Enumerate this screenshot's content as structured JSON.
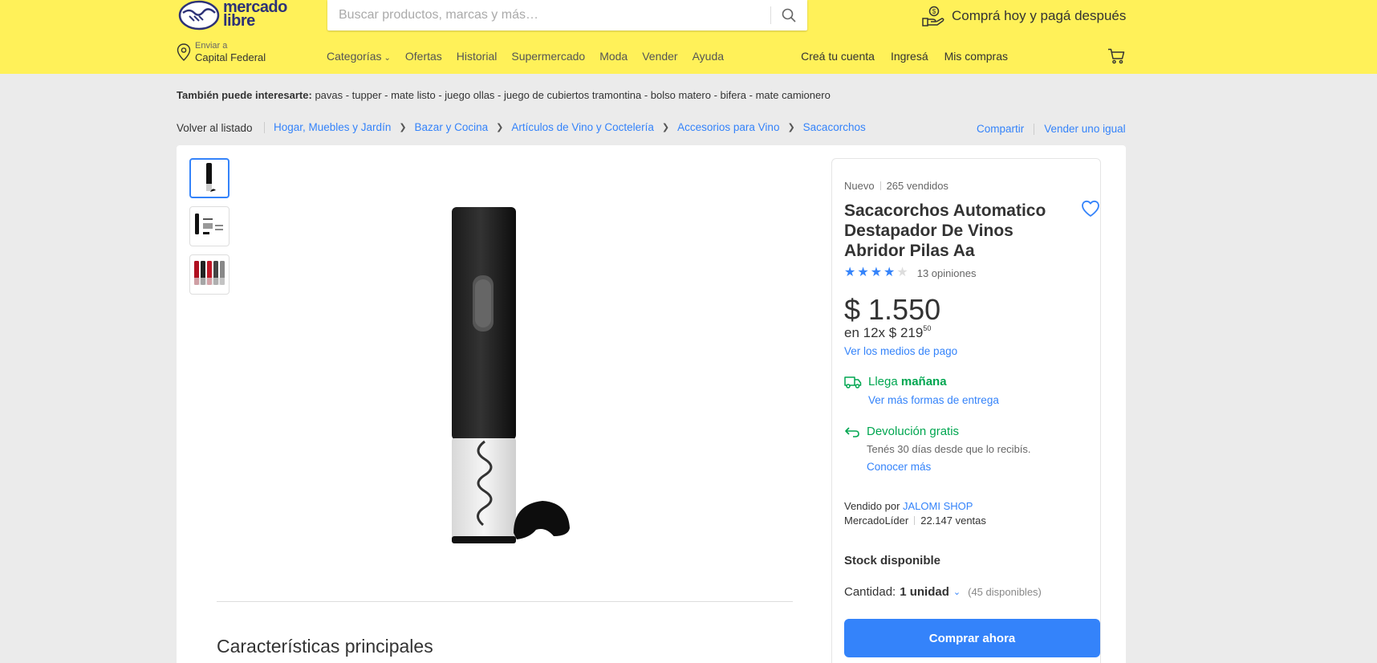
{
  "header": {
    "logo_text_line1": "mercado",
    "logo_text_line2": "libre",
    "search_placeholder": "Buscar productos, marcas y más…",
    "promo_text": "Comprá hoy y pagá después",
    "location_small": "Enviar a",
    "location_big": "Capital Federal",
    "nav": [
      "Categorías",
      "Ofertas",
      "Historial",
      "Supermercado",
      "Moda",
      "Vender",
      "Ayuda"
    ],
    "user_nav": [
      "Creá tu cuenta",
      "Ingresá",
      "Mis compras"
    ],
    "bg_color": "#fff159"
  },
  "interest": {
    "label": "También puede interesarte:",
    "items": "pavas - tupper - mate listo - juego ollas - juego de cubiertos tramontina - bolso matero - bifera - mate camionero"
  },
  "breadcrumb": {
    "back": "Volver al listado",
    "items": [
      "Hogar, Muebles y Jardín",
      "Bazar y Cocina",
      "Artículos de Vino y Coctelería",
      "Accesorios para Vino",
      "Sacacorchos"
    ],
    "share": "Compartir",
    "sell_same": "Vender uno igual"
  },
  "gallery": {
    "thumbs": [
      "thumb-1",
      "thumb-2",
      "thumb-3"
    ],
    "features_title": "Características principales"
  },
  "product": {
    "condition": "Nuevo",
    "sold": "265 vendidos",
    "title": "Sacacorchos Automatico Destapador De Vinos Abridor Pilas Aa",
    "rating": 4,
    "rating_max": 5,
    "reviews": "13 opiniones",
    "price": "$ 1.550",
    "installments": "en 12x $ 219",
    "installments_cents": "50",
    "payment_link": "Ver los medios de pago",
    "shipping_prefix": "Llega ",
    "shipping_day": "mañana",
    "shipping_link": "Ver más formas de entrega",
    "return_title": "Devolución gratis",
    "return_desc": "Tenés 30 días desde que lo recibís.",
    "return_link": "Conocer más",
    "sold_by": "Vendido por ",
    "seller_name": "JALOMI SHOP",
    "seller_level": "MercadoLíder",
    "seller_sales": "22.147 ventas",
    "stock": "Stock disponible",
    "qty_label": "Cantidad: ",
    "qty_value": "1 unidad",
    "qty_available": "(45 disponibles)",
    "buy_button": "Comprar ahora",
    "accent_color": "#3483fa",
    "green_color": "#00a650"
  }
}
